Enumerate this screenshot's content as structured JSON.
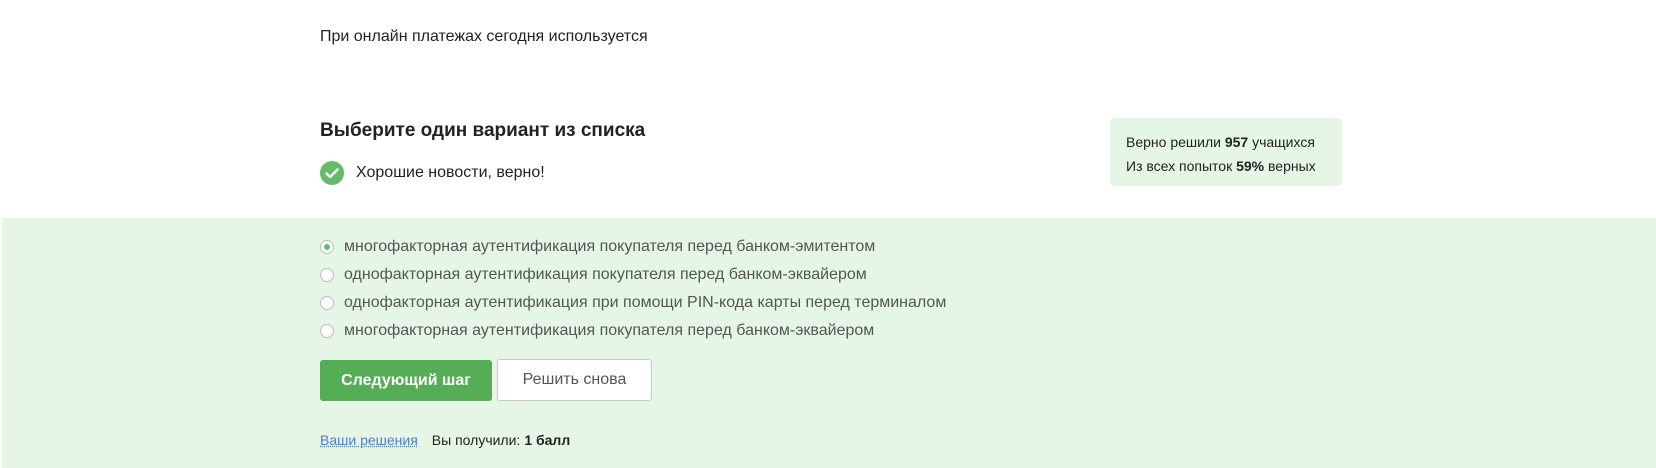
{
  "question": {
    "text": "При онлайн платежах сегодня используется"
  },
  "task": {
    "title": "Выберите один вариант из списка",
    "result_message": "Хорошие новости, верно!"
  },
  "stats": {
    "solved_prefix": "Верно решили ",
    "solved_count": "957",
    "solved_suffix": " учащихся",
    "attempts_prefix": "Из всех попыток ",
    "attempts_percent": "59%",
    "attempts_suffix": " верных"
  },
  "options": [
    {
      "label": "многофакторная аутентификация покупателя перед банком-эмитентом",
      "selected": true
    },
    {
      "label": "однофакторная аутентификация покупателя перед банком-эквайером",
      "selected": false
    },
    {
      "label": "однофакторная аутентификация при помощи PIN-кода карты перед терминалом",
      "selected": false
    },
    {
      "label": "многофакторная аутентификация покупателя перед банком-эквайером",
      "selected": false
    }
  ],
  "buttons": {
    "next": "Следующий шаг",
    "again": "Решить снова"
  },
  "footer": {
    "solutions_link": "Ваши решения",
    "score_label": "Вы получили:",
    "score_value": "1 балл"
  },
  "colors": {
    "accent_green": "#55ad55",
    "success_bg": "#e6f6e6",
    "link_blue": "#4a7fd6"
  },
  "icons": {
    "result": "check-circle-icon",
    "option_radio": "radio-icon"
  }
}
